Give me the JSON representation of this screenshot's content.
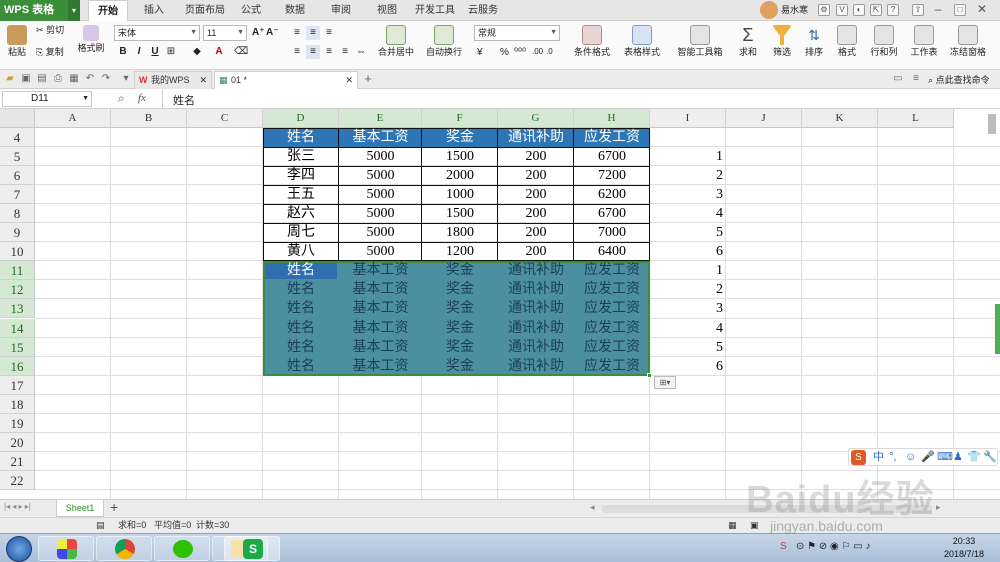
{
  "app": {
    "brand": "WPS 表格",
    "user": "易水寒"
  },
  "menu": [
    "开始",
    "插入",
    "页面布局",
    "公式",
    "数据",
    "审阅",
    "视图",
    "开发工具",
    "云服务"
  ],
  "ribbon": {
    "paste": "粘贴",
    "cut": "剪切",
    "copy": "复制",
    "format_painter": "格式刷",
    "font_name": "宋体",
    "font_size": "11",
    "merge_center": "合并居中",
    "wrap_text": "自动换行",
    "number_format": "常规",
    "conditional_format": "条件格式",
    "table_style": "表格样式",
    "smart_toolbox": "智能工具箱",
    "sum": "求和",
    "filter": "筛选",
    "sort": "排序",
    "format": "格式",
    "row_col": "行和列",
    "worksheet": "工作表",
    "freeze": "冻结窗格"
  },
  "tabs": {
    "home": "我的WPS",
    "doc": "01 *",
    "find_cmd": "点此查找命令"
  },
  "formula": {
    "name_box": "D11",
    "fx": "fx",
    "content": "姓名"
  },
  "columns": [
    "A",
    "B",
    "C",
    "D",
    "E",
    "F",
    "G",
    "H",
    "I",
    "J",
    "K",
    "L"
  ],
  "rows": [
    "4",
    "5",
    "6",
    "7",
    "8",
    "9",
    "10",
    "11",
    "12",
    "13",
    "14",
    "15",
    "16",
    "17",
    "18",
    "19",
    "20",
    "21",
    "22"
  ],
  "table": {
    "header": [
      "姓名",
      "基本工资",
      "奖金",
      "通讯补助",
      "应发工资"
    ],
    "rows": [
      [
        "张三",
        "5000",
        "1500",
        "200",
        "6700"
      ],
      [
        "李四",
        "5000",
        "2000",
        "200",
        "7200"
      ],
      [
        "王五",
        "5000",
        "1000",
        "200",
        "6200"
      ],
      [
        "赵六",
        "5000",
        "1500",
        "200",
        "6700"
      ],
      [
        "周七",
        "5000",
        "1800",
        "200",
        "7000"
      ],
      [
        "黄八",
        "5000",
        "1200",
        "200",
        "6400"
      ]
    ],
    "repeated_header_rows": 6
  },
  "col_i": [
    "1",
    "2",
    "3",
    "4",
    "5",
    "6",
    "1",
    "2",
    "3",
    "4",
    "5",
    "6"
  ],
  "sheet": {
    "name": "Sheet1"
  },
  "status": {
    "sum": "求和=0",
    "avg": "平均值=0",
    "count": "计数=30"
  },
  "clock": {
    "time": "20:33",
    "date": "2018/7/18"
  },
  "ime": {
    "lang": "中"
  },
  "watermark": {
    "text": "Baidu经验",
    "url": "jingyan.baidu.com"
  },
  "colors": {
    "header_fill": "#2e75b6",
    "selection_fill": "#4c8fa0",
    "accent_green": "#3a8e3a"
  }
}
